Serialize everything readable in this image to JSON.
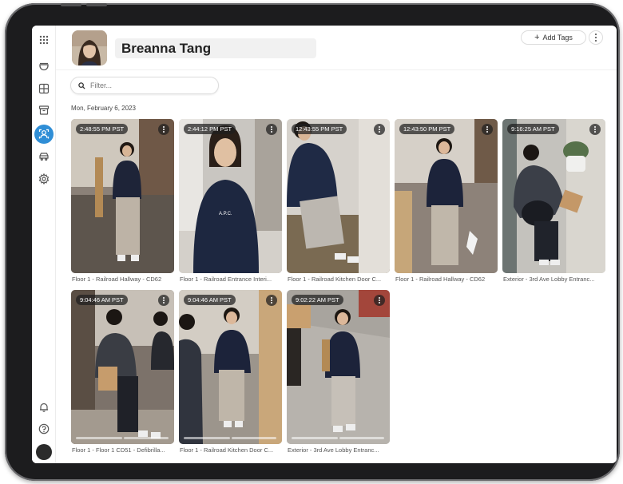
{
  "person": {
    "name": "Breanna Tang"
  },
  "header": {
    "add_tags_label": "Add Tags"
  },
  "filter": {
    "placeholder": "Filter..."
  },
  "date_group": {
    "label": "Mon, February 6, 2023"
  },
  "sidebar": {
    "icons": [
      "apps-grid-icon",
      "camera-dome-icon",
      "dashboard-grid-icon",
      "archive-box-icon",
      "people-search-icon",
      "vehicle-icon",
      "settings-gear-icon",
      "notifications-bell-icon",
      "help-icon"
    ],
    "active": "people-search-icon"
  },
  "sightings": [
    {
      "time": "2:48:55 PM PST",
      "camera": "Floor 1 - Railroad Hallway - CD62"
    },
    {
      "time": "2:44:12 PM PST",
      "camera": "Floor 1 - Railroad Entrance Interi..."
    },
    {
      "time": "12:43:55 PM PST",
      "camera": "Floor 1 - Railroad Kitchen Door C..."
    },
    {
      "time": "12:43:50 PM PST",
      "camera": "Floor 1 - Railroad Hallway - CD62"
    },
    {
      "time": "9:16:25 AM PST",
      "camera": "Exterior - 3rd Ave Lobby Entranc..."
    },
    {
      "time": "9:04:46 AM PST",
      "camera": "Floor 1 - Floor 1 CD51 - Defibrilla..."
    },
    {
      "time": "9:04:46 AM PST",
      "camera": "Floor 1 - Railroad Kitchen Door C..."
    },
    {
      "time": "9:02:22 AM PST",
      "camera": "Exterior - 3rd Ave Lobby Entranc..."
    }
  ],
  "colors": {
    "accent": "#2f8ed6",
    "bezel": "#1c1c1e"
  }
}
